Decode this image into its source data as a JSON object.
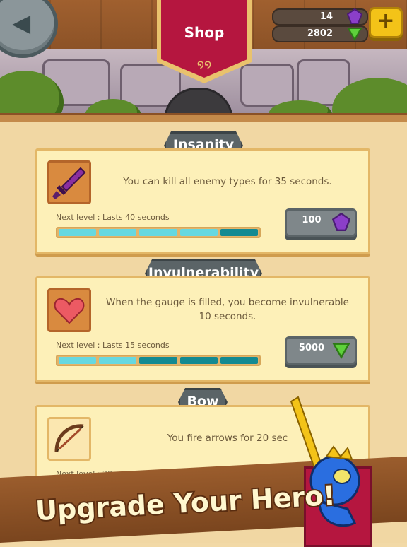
{
  "header": {
    "title": "Shop",
    "gems_count": "14",
    "coins_count": "2802",
    "add_label": "+"
  },
  "sections": [
    {
      "title": "Insanity",
      "description": "You can kill all enemy types for 35 seconds.",
      "next_level": "Next level : Lasts 40 seconds",
      "progress_filled": 4,
      "progress_total": 5,
      "price": "100",
      "price_currency_icon": "purple-gem-icon",
      "icon": "sword-icon"
    },
    {
      "title": "Invulnerability",
      "description": "When the gauge is filled, you become invulnerable 10 seconds.",
      "next_level": "Next level : Lasts 15 seconds",
      "progress_filled": 2,
      "progress_total": 5,
      "price": "5000",
      "price_currency_icon": "green-gem-icon",
      "icon": "heart-icon"
    },
    {
      "title": "Bow",
      "description": "You fire arrows for 20 sec",
      "next_level": "Next level : 20 seconds, Shoot every 1 seconds",
      "icon": "bow-icon"
    }
  ],
  "footer": {
    "slogan": "Upgrade Your Hero!"
  },
  "colors": {
    "banner_red": "#b5163f",
    "bar_filled": "#66d8e0",
    "bar_empty": "#138a92",
    "accent_gold": "#f3c318"
  }
}
